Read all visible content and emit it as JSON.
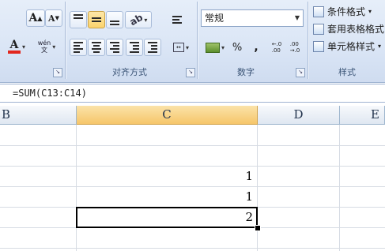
{
  "ribbon": {
    "font_group": {
      "grow_label": "A",
      "shrink_label": "A",
      "font_color_label": "A",
      "phonetic_label": "wén\n文"
    },
    "alignment": {
      "group_label": "对齐方式"
    },
    "number": {
      "format_value": "常规",
      "percent_label": "%",
      "comma_label": ",",
      "inc_decimal_label": "←.0\n.00",
      "dec_decimal_label": ".00\n→.0",
      "group_label": "数字"
    },
    "styles": {
      "conditional_label": "条件格式",
      "table_format_label": "套用表格格式",
      "cell_style_label": "单元格样式",
      "group_label": "样式"
    }
  },
  "formula_bar": {
    "formula": "=SUM(C13:C14)"
  },
  "grid": {
    "columns": [
      "B",
      "C",
      "D",
      "E"
    ],
    "selected_column": "C",
    "cells": [
      {
        "value": "1"
      },
      {
        "value": "1"
      },
      {
        "value": "2"
      }
    ]
  }
}
